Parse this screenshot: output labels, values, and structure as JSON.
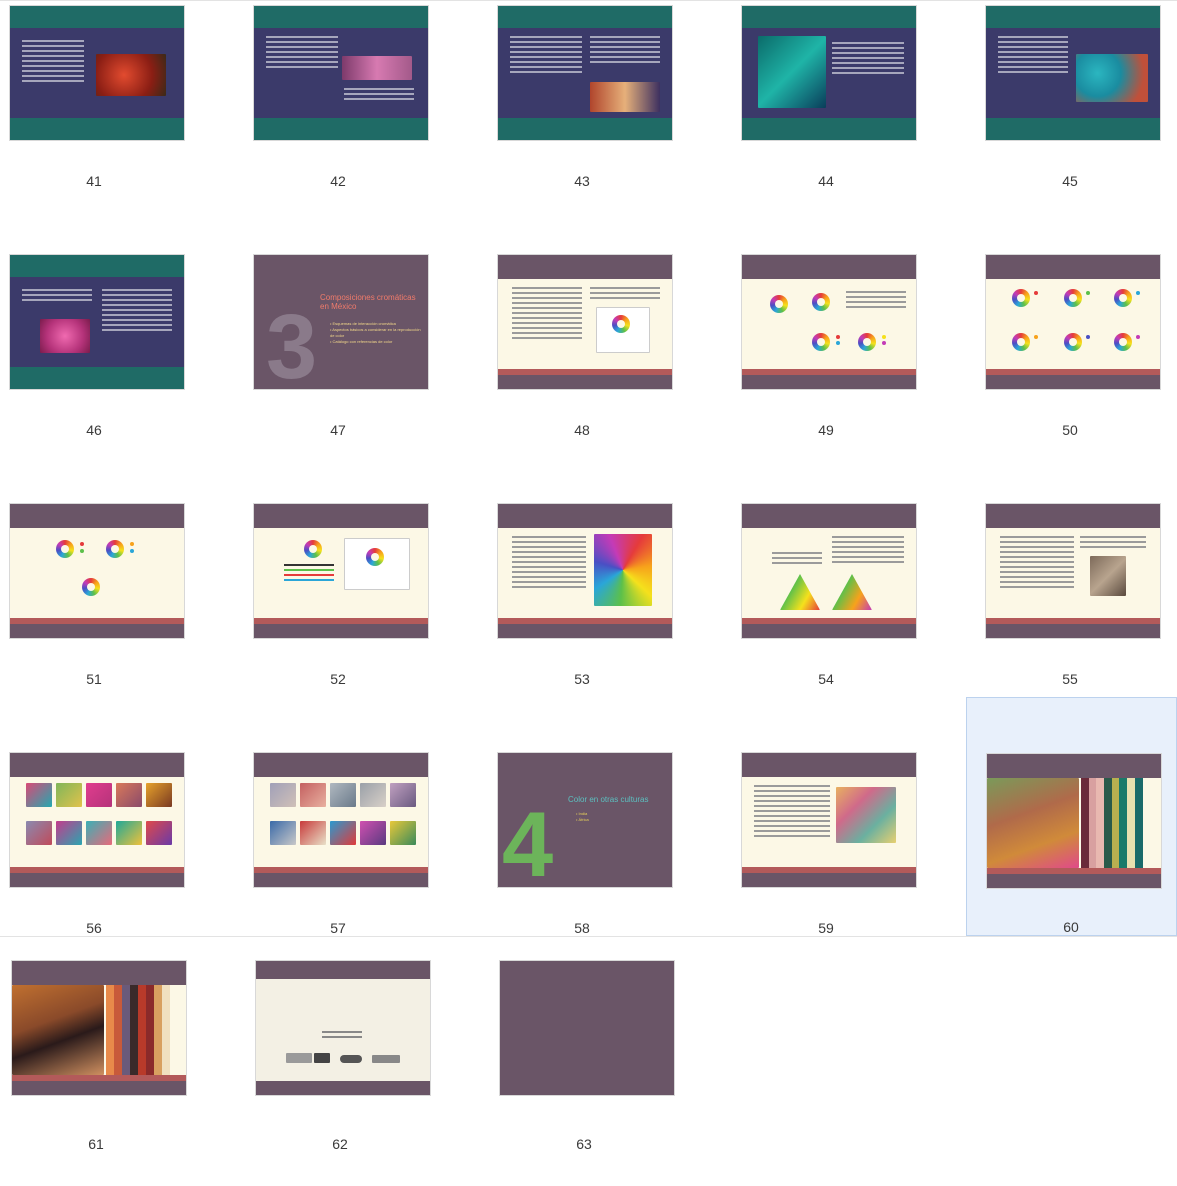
{
  "view": {
    "selected_page": "60",
    "pages": [
      {
        "number": "41",
        "theme": "navy-green"
      },
      {
        "number": "42",
        "theme": "navy-green"
      },
      {
        "number": "43",
        "theme": "navy-green"
      },
      {
        "number": "44",
        "theme": "navy-green"
      },
      {
        "number": "45",
        "theme": "navy-green"
      },
      {
        "number": "46",
        "theme": "navy-green"
      },
      {
        "number": "47",
        "theme": "section"
      },
      {
        "number": "48",
        "theme": "cream"
      },
      {
        "number": "49",
        "theme": "cream"
      },
      {
        "number": "50",
        "theme": "cream"
      },
      {
        "number": "51",
        "theme": "cream"
      },
      {
        "number": "52",
        "theme": "cream"
      },
      {
        "number": "53",
        "theme": "cream"
      },
      {
        "number": "54",
        "theme": "cream"
      },
      {
        "number": "55",
        "theme": "cream"
      },
      {
        "number": "56",
        "theme": "cream"
      },
      {
        "number": "57",
        "theme": "cream"
      },
      {
        "number": "58",
        "theme": "section"
      },
      {
        "number": "59",
        "theme": "cream"
      },
      {
        "number": "60",
        "theme": "cream"
      },
      {
        "number": "61",
        "theme": "cream"
      },
      {
        "number": "62",
        "theme": "credits"
      },
      {
        "number": "63",
        "theme": "blank"
      }
    ]
  },
  "slides": {
    "s47": {
      "big_number": "3",
      "title": "Composiciones cromáticas en México",
      "bullets": [
        "Esquemas de interacción cromática",
        "Aspectos básicos a considerar en la reproducción de color",
        "Catálogo con referencias de color"
      ]
    },
    "s58": {
      "big_number": "4",
      "title": "Color en otras culturas",
      "bullets": [
        "India",
        "África"
      ]
    }
  },
  "colors": {
    "navy": "#3b3a6a",
    "teal": "#1f6b66",
    "green": "#6cc24a",
    "mauve": "#6a5567",
    "cream": "#fcf8e6",
    "red": "#b35a5a",
    "selection": "#e8f0fb"
  }
}
